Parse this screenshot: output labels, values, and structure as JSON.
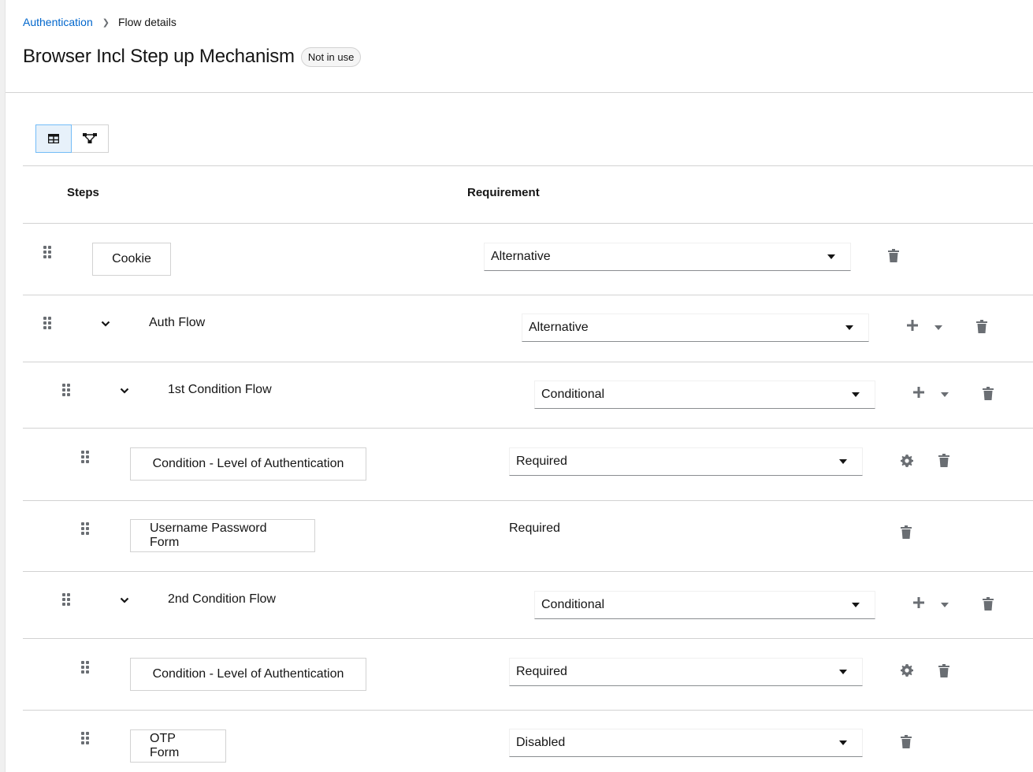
{
  "breadcrumb": {
    "parent": "Authentication",
    "current": "Flow details"
  },
  "page": {
    "title": "Browser Incl Step up Mechanism",
    "badge": "Not in use"
  },
  "table": {
    "col_steps": "Steps",
    "col_requirement": "Requirement"
  },
  "rows": [
    {
      "name": "Cookie",
      "type": "execution",
      "requirement": "Alternative"
    },
    {
      "name": "Auth Flow",
      "type": "flow",
      "requirement": "Alternative"
    },
    {
      "name": "1st Condition Flow",
      "type": "flow",
      "requirement": "Conditional"
    },
    {
      "name": "Condition - Level of Authentication",
      "type": "execution",
      "requirement": "Required"
    },
    {
      "name": "Username Password Form",
      "type": "execution",
      "requirement": "Required"
    },
    {
      "name": "2nd Condition Flow",
      "type": "flow",
      "requirement": "Conditional"
    },
    {
      "name": "Condition - Level of Authentication",
      "type": "execution",
      "requirement": "Required"
    },
    {
      "name": "OTP Form",
      "type": "execution",
      "requirement": "Disabled"
    }
  ],
  "icons": {
    "table_view": "table-icon",
    "diagram_view": "diagram-icon",
    "drag": "drag-handle-icon",
    "expand": "chevron-down-icon",
    "add": "plus-icon",
    "settings": "gear-icon",
    "delete": "trash-icon"
  },
  "colors": {
    "link": "#0066cc",
    "active_toggle": "#e7f1fa",
    "icon": "#6a6e73"
  }
}
